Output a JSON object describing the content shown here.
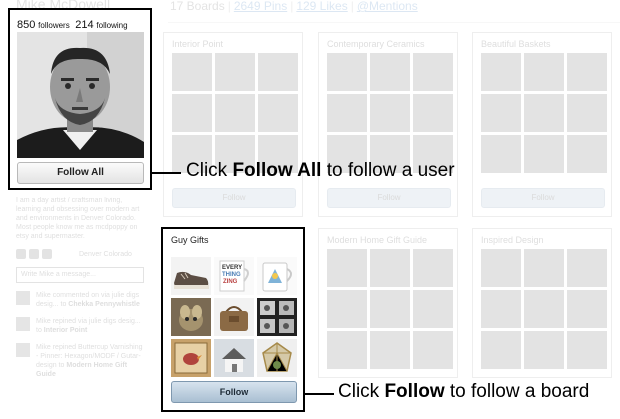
{
  "header": {
    "user_name": "Mike McDowell",
    "boards_count": "17 Boards",
    "pins_link": "2649 Pins",
    "likes_link": "129 Likes",
    "mentions_link": "@Mentions"
  },
  "profile": {
    "followers_count": "850",
    "followers_label": "followers",
    "following_count": "214",
    "following_label": "following",
    "follow_all_label": "Follow All"
  },
  "sidebar": {
    "bio": "I am a day artist / craftsman living, learning and obsessing over modern art and environments in Denver Colorado. Most people know me as mcdpoppy on etsy and supermaster.",
    "location": "Denver Colorado",
    "message_placeholder": "Write Mike a message...",
    "activity": [
      {
        "text_a": "Mike commented on via julie digs desig... to ",
        "text_b": "Chekka Pennywhistle"
      },
      {
        "text_a": "Mike repined via julie digs desig... to ",
        "text_b": "Interior Point"
      },
      {
        "text_a": "Mike repined Buttercup Varnishing - Pinner: Hexagon/MODF / Gutar-design to ",
        "text_b": "Modern Home Gift Guide"
      }
    ]
  },
  "boards": [
    {
      "title": "Interior Point",
      "button": "Follow"
    },
    {
      "title": "Contemporary Ceramics",
      "button": "Follow"
    },
    {
      "title": "Beautiful Baskets",
      "button": "Follow"
    },
    {
      "title": "Modern Home Gift Guide",
      "button": "Follow"
    },
    {
      "title": "Inspired Design",
      "button": "Follow"
    }
  ],
  "highlight_board": {
    "title": "Guy Gifts",
    "follow_label": "Follow",
    "thumbs": [
      "sneaker",
      "every-thing-mug",
      "bird-mug",
      "dog-painting",
      "leather-bag",
      "photo-strip",
      "bird-painting",
      "tiny-house",
      "geometric-terrarium"
    ]
  },
  "callouts": {
    "top_prefix": "Click ",
    "top_bold": "Follow All",
    "top_suffix": " to follow a user",
    "bottom_prefix": "Click ",
    "bottom_bold": "Follow",
    "bottom_suffix": " to follow a board"
  }
}
